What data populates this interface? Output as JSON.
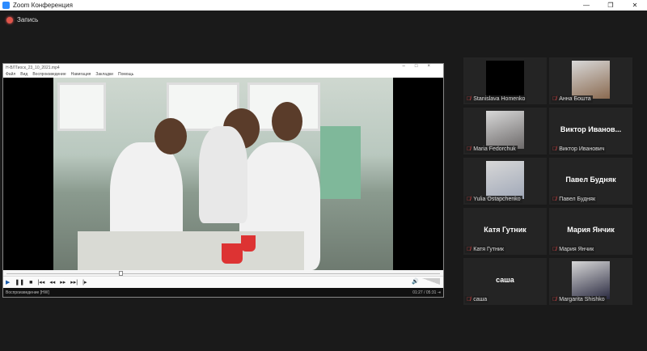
{
  "app_title": "Zoom Конференция",
  "window_controls": [
    "—",
    "❐",
    "✕"
  ],
  "recording_label": "Запись",
  "player": {
    "title": "H-ВЛТиоск_23_10_2021.mp4",
    "menu": [
      "Файл",
      "Вид",
      "Воспроизведение",
      "Навигация",
      "Закладки",
      "Помощь"
    ],
    "progress_fraction": 0.26,
    "controls": [
      "▶",
      "❚❚",
      "■",
      "|◂◂",
      "◂◂",
      "▸▸",
      "▸▸|",
      "|▸"
    ],
    "volume_icon": "🔊",
    "status_text": "Воспроизведение [HW]",
    "time": "01:27 / 05:31",
    "status_end": "⇥"
  },
  "participants": [
    {
      "name": "Stanislava Homenko",
      "video": "black"
    },
    {
      "name": "Анна Бошта",
      "video": "photo"
    },
    {
      "name": "Maria Fedorchuk",
      "video": "photo"
    },
    {
      "name": "Виктор Иванович",
      "display": "Виктор  Иванов..."
    },
    {
      "name": "Yulia Ostapchenko",
      "video": "photo"
    },
    {
      "name": "Павел Будняк",
      "display": "Павел Будняк"
    },
    {
      "name": "Катя Гутник",
      "display": "Катя Гутник"
    },
    {
      "name": "Мария Янчик",
      "display": "Мария Янчик"
    },
    {
      "name": "саша",
      "display": "саша"
    },
    {
      "name": "Margarita Shishko",
      "video": "photo"
    }
  ]
}
